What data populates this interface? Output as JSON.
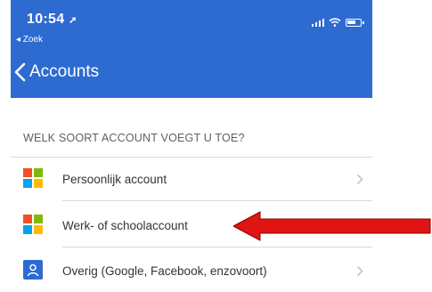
{
  "status_bar": {
    "time": "10:54",
    "back_app_label": "◂ Zoek"
  },
  "nav": {
    "back_label": "Accounts"
  },
  "section": {
    "header": "WELK SOORT ACCOUNT VOEGT U TOE?"
  },
  "accounts": [
    {
      "label": "Persoonlijk account",
      "icon": "microsoft-logo-icon"
    },
    {
      "label": "Werk- of schoolaccount",
      "icon": "microsoft-logo-icon"
    },
    {
      "label": "Overig (Google, Facebook, enzovoort)",
      "icon": "person-icon"
    }
  ],
  "colors": {
    "nav_background": "#2d6bd1",
    "annotation_arrow": "#e11414",
    "ms_red": "#f25022",
    "ms_green": "#7fba00",
    "ms_blue": "#00a4ef",
    "ms_yellow": "#ffb900"
  }
}
